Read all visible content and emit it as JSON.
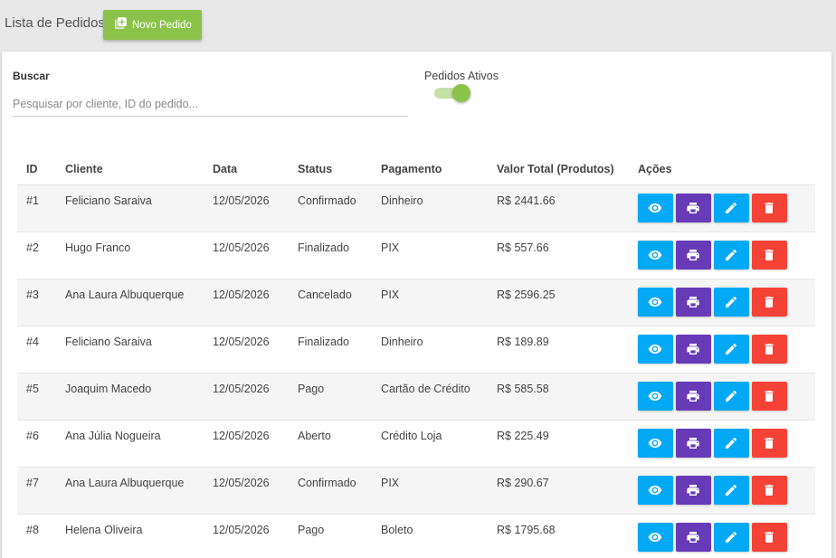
{
  "header": {
    "title": "Lista de Pedidos",
    "new_button_label": "Novo Pedido"
  },
  "filters": {
    "search_label": "Buscar",
    "search_placeholder": "Pesquisar por cliente, ID do pedido...",
    "search_value": "",
    "active_label": "Pedidos Ativos",
    "active_on": true
  },
  "table": {
    "columns": [
      "ID",
      "Cliente",
      "Data",
      "Status",
      "Pagamento",
      "Valor Total (Produtos)",
      "Ações"
    ],
    "rows": [
      {
        "id": "#1",
        "cliente": "Feliciano Saraiva",
        "data": "12/05/2026",
        "status": "Confirmado",
        "pagamento": "Dinheiro",
        "valor": "R$ 2441.66"
      },
      {
        "id": "#2",
        "cliente": "Hugo Franco",
        "data": "12/05/2026",
        "status": "Finalizado",
        "pagamento": "PIX",
        "valor": "R$ 557.66"
      },
      {
        "id": "#3",
        "cliente": "Ana Laura Albuquerque",
        "data": "12/05/2026",
        "status": "Cancelado",
        "pagamento": "PIX",
        "valor": "R$ 2596.25"
      },
      {
        "id": "#4",
        "cliente": "Feliciano Saraiva",
        "data": "12/05/2026",
        "status": "Finalizado",
        "pagamento": "Dinheiro",
        "valor": "R$ 189.89"
      },
      {
        "id": "#5",
        "cliente": "Joaquim Macedo",
        "data": "12/05/2026",
        "status": "Pago",
        "pagamento": "Cartão de Crédito",
        "valor": "R$ 585.58"
      },
      {
        "id": "#6",
        "cliente": "Ana Júlia Nogueira",
        "data": "12/05/2026",
        "status": "Aberto",
        "pagamento": "Crédito Loja",
        "valor": "R$ 225.49"
      },
      {
        "id": "#7",
        "cliente": "Ana Laura Albuquerque",
        "data": "12/05/2026",
        "status": "Confirmado",
        "pagamento": "PIX",
        "valor": "R$ 290.67"
      },
      {
        "id": "#8",
        "cliente": "Helena Oliveira",
        "data": "12/05/2026",
        "status": "Pago",
        "pagamento": "Boleto",
        "valor": "R$ 1795.68"
      }
    ],
    "action_icons": [
      "eye-icon",
      "print-icon",
      "pencil-icon",
      "trash-icon"
    ]
  },
  "colors": {
    "primary_green": "#8bc34a",
    "view_blue": "#03a9f4",
    "print_purple": "#673ab7",
    "delete_red": "#f44336"
  }
}
